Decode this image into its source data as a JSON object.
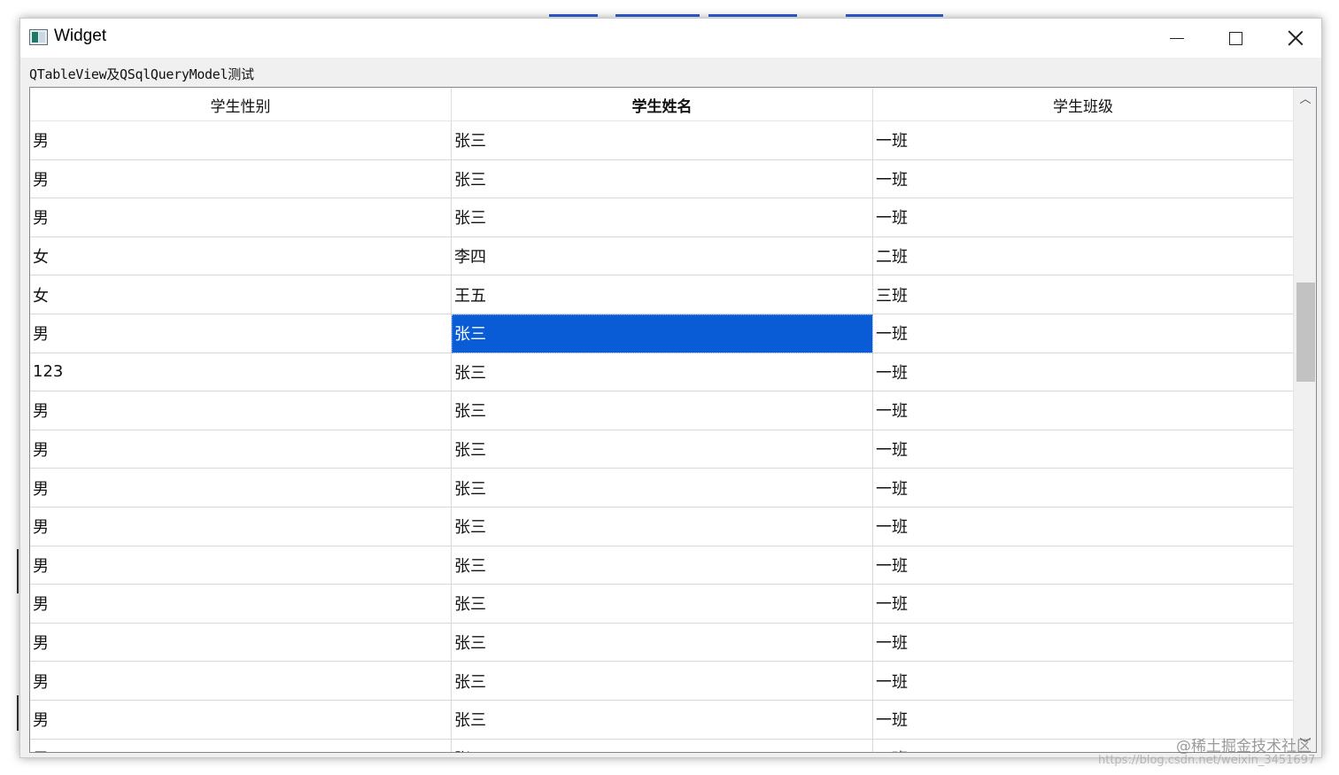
{
  "window": {
    "title": "Widget",
    "caption": "QTableView及QSqlQueryModel测试"
  },
  "table": {
    "headers": [
      "学生性别",
      "学生姓名",
      "学生班级"
    ],
    "bold_header_index": 1,
    "rows": [
      [
        "男",
        "张三",
        "一班"
      ],
      [
        "男",
        "张三",
        "一班"
      ],
      [
        "男",
        "张三",
        "一班"
      ],
      [
        "女",
        "李四",
        "二班"
      ],
      [
        "女",
        "王五",
        "三班"
      ],
      [
        "男",
        "张三",
        "一班"
      ],
      [
        "123",
        "张三",
        "一班"
      ],
      [
        "男",
        "张三",
        "一班"
      ],
      [
        "男",
        "张三",
        "一班"
      ],
      [
        "男",
        "张三",
        "一班"
      ],
      [
        "男",
        "张三",
        "一班"
      ],
      [
        "男",
        "张三",
        "一班"
      ],
      [
        "男",
        "张三",
        "一班"
      ],
      [
        "男",
        "张三",
        "一班"
      ],
      [
        "男",
        "张三",
        "一班"
      ],
      [
        "男",
        "张三",
        "一班"
      ],
      [
        "男",
        "张三",
        "一班"
      ]
    ],
    "selected_cell": {
      "row": 5,
      "col": 1
    },
    "selection_color": "#0a5bd6"
  },
  "icons": {
    "app": "window-app-icon",
    "minimize": "minimize-icon",
    "maximize": "maximize-icon",
    "close": "close-icon",
    "scroll_up": "chevron-up-icon",
    "scroll_down": "chevron-down-icon"
  },
  "watermark": {
    "line1": "@稀土掘金技术社区",
    "line2": "https://blog.csdn.net/weixin_3451697"
  }
}
